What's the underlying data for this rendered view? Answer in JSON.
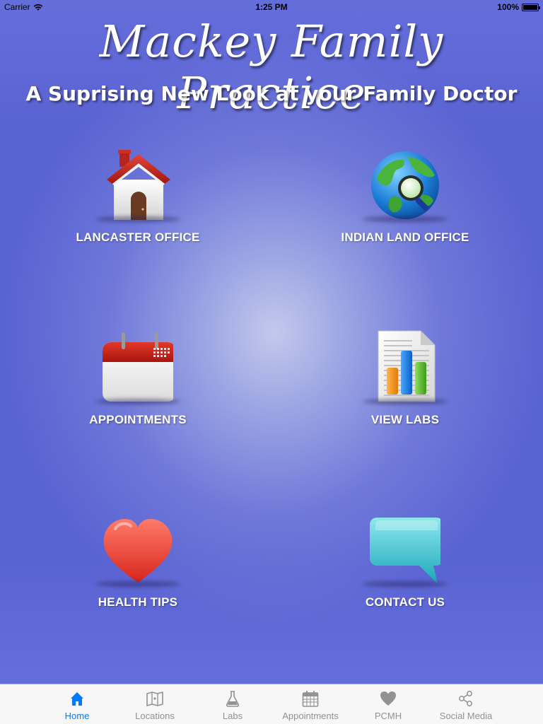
{
  "status_bar": {
    "carrier": "Carrier",
    "time": "1:25 PM",
    "battery": "100%"
  },
  "header": {
    "title": "Mackey Family Practice",
    "subtitle": "A Suprising New Look at your Family Doctor"
  },
  "tiles": [
    {
      "label": "LANCASTER OFFICE",
      "icon": "house-icon"
    },
    {
      "label": "INDIAN LAND OFFICE",
      "icon": "globe-search-icon"
    },
    {
      "label": "APPOINTMENTS",
      "icon": "calendar-icon"
    },
    {
      "label": "VIEW LABS",
      "icon": "report-chart-icon"
    },
    {
      "label": "HEALTH TIPS",
      "icon": "heart-icon"
    },
    {
      "label": "CONTACT US",
      "icon": "speech-bubble-icon"
    }
  ],
  "tab_bar": {
    "active": "Home",
    "colors": {
      "active": "#007aff",
      "inactive": "#929292"
    },
    "tabs": [
      {
        "label": "Home",
        "icon": "home-icon"
      },
      {
        "label": "Locations",
        "icon": "map-icon"
      },
      {
        "label": "Labs",
        "icon": "flask-icon"
      },
      {
        "label": "Appointments",
        "icon": "calendar-icon"
      },
      {
        "label": "PCMH",
        "icon": "heart-icon"
      },
      {
        "label": "Social Media",
        "icon": "share-icon"
      }
    ]
  }
}
